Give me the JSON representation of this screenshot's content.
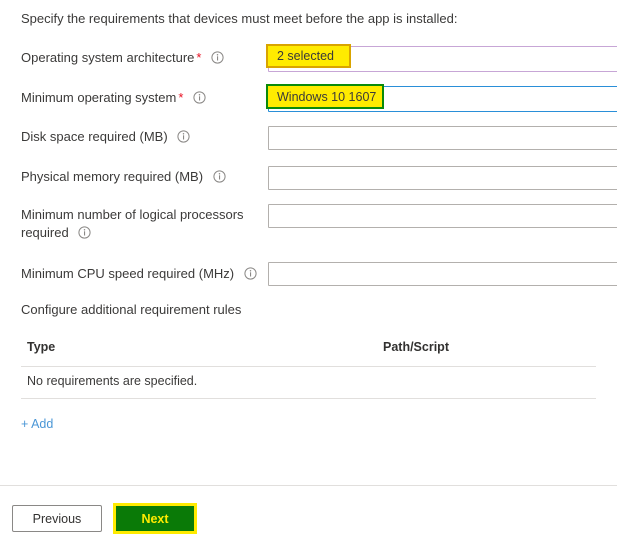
{
  "intro": {
    "text": "Specify the requirements that devices must meet before the app is installed:"
  },
  "fields": [
    {
      "label": "Operating system architecture",
      "required_marker": "*",
      "value": "2 selected",
      "control": "dropdown",
      "highlight": "yellow",
      "highlight_border": "#d9a400",
      "field_border": "#c7a6d6"
    },
    {
      "label": "Minimum operating system",
      "required_marker": "*",
      "value": "Windows 10 1607",
      "control": "dropdown",
      "highlight": "yellow",
      "highlight_border": "#0a8a0a",
      "field_border": "#2a8fd8"
    },
    {
      "label": "Disk space required (MB)",
      "required_marker": "",
      "value": "",
      "placeholder": "",
      "control": "text"
    },
    {
      "label": "Physical memory required (MB)",
      "required_marker": "",
      "value": "",
      "placeholder": "",
      "control": "text"
    },
    {
      "label": "Minimum number of logical processors required",
      "label_line1": "Minimum number of logical processors",
      "label_line2": "required",
      "required_marker": "",
      "value": "",
      "placeholder": "",
      "control": "text"
    },
    {
      "label": "Minimum CPU speed required (MHz)",
      "required_marker": "",
      "value": "",
      "placeholder": "",
      "control": "text"
    }
  ],
  "section": {
    "heading": "Configure additional requirement rules"
  },
  "table": {
    "columns": [
      "Type",
      "Path/Script"
    ],
    "empty_message": "No requirements are specified.",
    "rows": []
  },
  "add_link": {
    "label": "+ Add"
  },
  "footer": {
    "previous_label": "Previous",
    "next_label": "Next",
    "next_bg": "#0a7a07",
    "next_fg": "#ffeb00",
    "next_outline": "#ffeb00"
  },
  "colors": {
    "highlight_yellow": "#ffeb00",
    "required_red": "#e81123",
    "link_blue": "#4a96d6",
    "text": "#3b3a39"
  },
  "icons": {
    "info": "info-icon"
  }
}
